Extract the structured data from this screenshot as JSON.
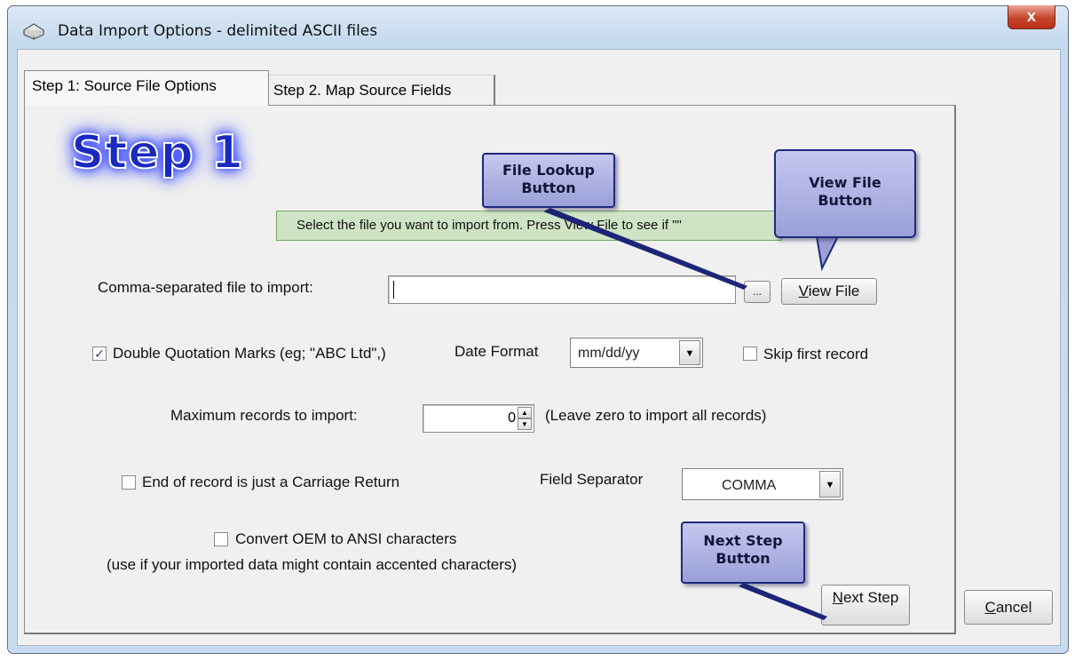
{
  "window": {
    "title": "Data Import Options - delimited ASCII files",
    "close_glyph": "x",
    "icon": "import-box-icon"
  },
  "tabs": [
    {
      "label": "Step 1: Source File Options",
      "active": true
    },
    {
      "label": "Step 2. Map Source Fields",
      "active": false
    }
  ],
  "step_banner": "Step 1",
  "info_message": "Select the file you want to import from. Press View File to see if \"\"",
  "file_import": {
    "label": "Comma-separated file to import:",
    "value": "",
    "lookup_button": "...",
    "view_button_first": "V",
    "view_button_rest": "iew File"
  },
  "options": {
    "double_quotes": {
      "label": "Double Quotation Marks (eg; \"ABC Ltd\",)",
      "checked": true
    },
    "date_format": {
      "label": "Date Format",
      "value": "mm/dd/yy"
    },
    "skip_first": {
      "label": "Skip first record",
      "checked": false
    },
    "max_records": {
      "label": "Maximum records to import:",
      "value": "0",
      "hint": "(Leave zero to import all records)"
    },
    "carriage_return": {
      "label": "End of record is just a Carriage Return",
      "checked": false
    },
    "field_separator": {
      "label": "Field Separator",
      "value": "COMMA"
    },
    "convert_oem": {
      "label": "Convert OEM to ANSI characters",
      "checked": false,
      "note": "(use if your imported data might contain accented characters)"
    }
  },
  "buttons": {
    "next_first": "N",
    "next_rest": "ext Step",
    "cancel_first": "C",
    "cancel_rest": "ancel"
  },
  "callouts": {
    "file_lookup": [
      "File Lookup",
      "Button"
    ],
    "view_file": [
      "View File",
      "Button"
    ],
    "next_step": [
      "Next Step",
      "Button"
    ]
  },
  "colors": {
    "callout_fill": "#9a9fd8",
    "callout_border": "#1e2a7a",
    "info_bar": "#cfe4c4",
    "step_text": "#1a2abf"
  }
}
